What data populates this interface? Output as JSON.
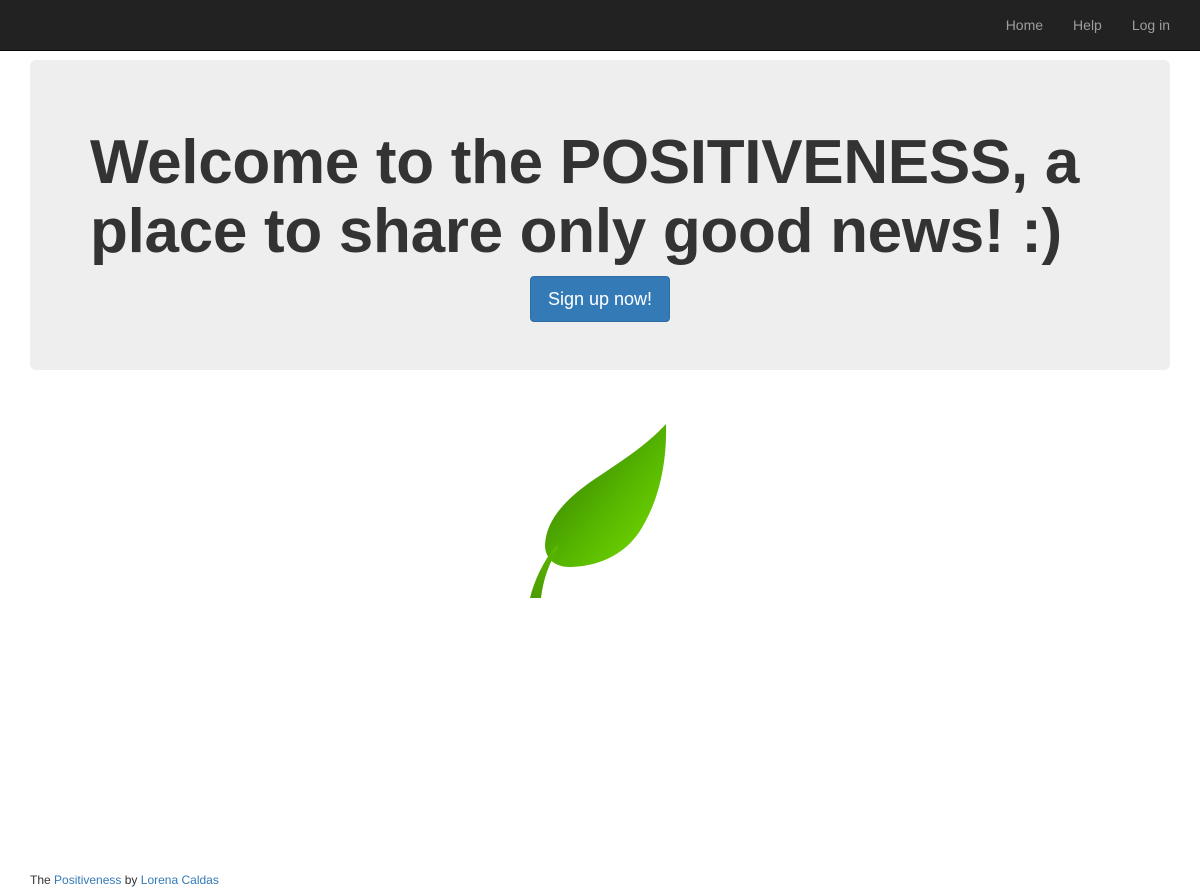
{
  "nav": {
    "links": [
      {
        "label": "Home"
      },
      {
        "label": "Help"
      },
      {
        "label": "Log in"
      }
    ]
  },
  "hero": {
    "title": "Welcome to the POSITIVENESS, a place to share only good news! :)",
    "signup_label": "Sign up now!"
  },
  "footer": {
    "prefix": "The",
    "brand_link": "Positiveness",
    "by": "by",
    "author_link": "Lorena Caldas"
  },
  "icons": {
    "leaf": "leaf-icon"
  },
  "colors": {
    "navbar": "#222222",
    "nav_link": "#9d9d9d",
    "jumbotron": "#eeeeee",
    "primary": "#337ab7",
    "leaf_light": "#6ccf00",
    "leaf_dark": "#3f7f00"
  }
}
